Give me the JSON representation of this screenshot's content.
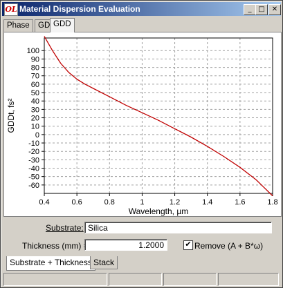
{
  "window": {
    "title": "Material Dispersion Evaluation",
    "icon_text": "OL",
    "minimize": "_",
    "maximize": "□",
    "close": "✕"
  },
  "tabs": [
    {
      "label": "Phase",
      "active": false
    },
    {
      "label": "GD",
      "active": false
    },
    {
      "label": "GDD",
      "active": true
    }
  ],
  "chart_data": {
    "type": "line",
    "xlabel": "Wavelength, µm",
    "ylabel": "GDDt, fs²",
    "xlim": [
      0.4,
      1.8
    ],
    "ylim": [
      -70,
      115
    ],
    "xticks": [
      0.4,
      0.6,
      0.8,
      1,
      1.2,
      1.4,
      1.6,
      1.8
    ],
    "xtick_labels": [
      "0.4",
      "0.6",
      "0.8",
      "1",
      "1.2",
      "1.4",
      "1.6",
      "1.8"
    ],
    "yticks": [
      -60,
      -50,
      -40,
      -30,
      -20,
      -10,
      0,
      10,
      20,
      30,
      40,
      50,
      60,
      70,
      80,
      90,
      100
    ],
    "ytick_labels": [
      "-60",
      "-50",
      "-40",
      "-30",
      "-20",
      "-10",
      "0",
      "10",
      "20",
      "30",
      "40",
      "50",
      "60",
      "70",
      "80",
      "90",
      "100"
    ],
    "grid": true,
    "color": "#c00000",
    "series": [
      {
        "x": [
          0.4,
          0.45,
          0.5,
          0.55,
          0.6,
          0.65,
          0.7,
          0.8,
          0.9,
          1.0,
          1.1,
          1.2,
          1.3,
          1.4,
          1.5,
          1.6,
          1.7,
          1.8
        ],
        "values": [
          117,
          100,
          85,
          74,
          66,
          60,
          55,
          45,
          35,
          26,
          17,
          7,
          -3,
          -14,
          -26,
          -39,
          -54,
          -73
        ]
      }
    ]
  },
  "form": {
    "substrate_label": "Substrate:",
    "substrate_value": "Silica",
    "thickness_label": "Thickness (mm) =",
    "thickness_value": "1.2000",
    "remove_label": "Remove (A + B*ω)",
    "remove_checked": true,
    "check_mark": "✔"
  },
  "bottom_tabs": [
    {
      "label": "Substrate + Thickness",
      "active": true
    },
    {
      "label": "Stack",
      "active": false
    }
  ]
}
